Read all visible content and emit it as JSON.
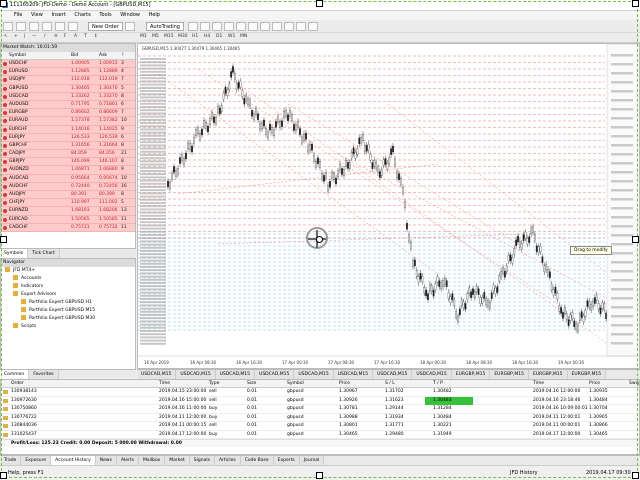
{
  "window": {
    "title": "111165209: JFD-Demo - Demo Account - [GBPUSD,M15]"
  },
  "menu": [
    "File",
    "View",
    "Insert",
    "Charts",
    "Tools",
    "Window",
    "Help"
  ],
  "toolbar": {
    "new_order": "New Order",
    "auto_trading": "AutoTrading"
  },
  "timeframes": [
    "M1",
    "M5",
    "M15",
    "M30",
    "H1",
    "H4",
    "D1",
    "W1",
    "MN"
  ],
  "market_watch": {
    "title": "Market Watch: 16:01:59",
    "columns": [
      "Symbol",
      "Bid",
      "Ask",
      "!"
    ],
    "rows": [
      {
        "symbol": "USDCHF",
        "bid": "1.00905",
        "ask": "1.00915",
        "spread": "3"
      },
      {
        "symbol": "EURUSD",
        "bid": "1.12885",
        "ask": "1.12889",
        "spread": "4"
      },
      {
        "symbol": "USDJPY",
        "bid": "112.018",
        "ask": "112.019",
        "spread": "7"
      },
      {
        "symbol": "GBPUSD",
        "bid": "1.30465",
        "ask": "1.30470",
        "spread": "5"
      },
      {
        "symbol": "USDCAD",
        "bid": "1.33262",
        "ask": "1.33270",
        "spread": "8"
      },
      {
        "symbol": "AUDUSD",
        "bid": "0.71795",
        "ask": "0.71801",
        "spread": "6"
      },
      {
        "symbol": "EURGBP",
        "bid": "0.86602",
        "ask": "0.86609",
        "spread": "7"
      },
      {
        "symbol": "EURAUD",
        "bid": "1.57378",
        "ask": "1.57382",
        "spread": "10"
      },
      {
        "symbol": "EURCHF",
        "bid": "1.14016",
        "ask": "1.14025",
        "spread": "9"
      },
      {
        "symbol": "EURJPY",
        "bid": "126.533",
        "ask": "126.539",
        "spread": "6"
      },
      {
        "symbol": "GBPCHF",
        "bid": "1.31656",
        "ask": "1.31664",
        "spread": "8"
      },
      {
        "symbol": "CADJPY",
        "bid": "84.059",
        "ask": "84.056",
        "spread": "21"
      },
      {
        "symbol": "GBPJPY",
        "bid": "146.099",
        "ask": "146.107",
        "spread": "8"
      },
      {
        "symbol": "AUDNZD",
        "bid": "1.06871",
        "ask": "1.06880",
        "spread": "9"
      },
      {
        "symbol": "AUDCAD",
        "bid": "0.95664",
        "ask": "0.95674",
        "spread": "10"
      },
      {
        "symbol": "AUDCHF",
        "bid": "0.72440",
        "ask": "0.72456",
        "spread": "16"
      },
      {
        "symbol": "AUDJPY",
        "bid": "80.391",
        "ask": "80.399",
        "spread": "8"
      },
      {
        "symbol": "CHFJPY",
        "bid": "110.997",
        "ask": "111.002",
        "spread": "5"
      },
      {
        "symbol": "EURNZD",
        "bid": "1.68193",
        "ask": "1.68206",
        "spread": "13"
      },
      {
        "symbol": "EURCAD",
        "bid": "1.50565",
        "ask": "1.50585",
        "spread": "11"
      },
      {
        "symbol": "CADCHF",
        "bid": "0.75721",
        "ask": "0.75732",
        "spread": "11"
      }
    ],
    "tabs": [
      "Symbols",
      "Tick Chart"
    ]
  },
  "navigator": {
    "title": "Navigator",
    "items": [
      {
        "label": "JFD MT4+",
        "level": 0
      },
      {
        "label": "Accounts",
        "level": 1
      },
      {
        "label": "Indicators",
        "level": 1
      },
      {
        "label": "Expert Advisors",
        "level": 1
      },
      {
        "label": "Portfolio Expert GBPUSD H1",
        "level": 2
      },
      {
        "label": "Portfolio Expert GBPUSD M15",
        "level": 2
      },
      {
        "label": "Portfolio Expert GBPUSD M30",
        "level": 2
      },
      {
        "label": "Scripts",
        "level": 1
      }
    ],
    "tabs": [
      "Common",
      "Favorites"
    ]
  },
  "chart": {
    "info": "GBPUSD,M15  1.30477 1.30479 1.30465 1.30465",
    "tooltip": "Drag to modify",
    "time_labels": [
      "16 Apr 2019",
      "16 Apr 08:30",
      "16 Apr 16:30",
      "17 Apr 00:30",
      "17 Apr 08:30",
      "17 Apr 16:30",
      "18 Apr 00:30",
      "18 Apr 08:30",
      "18 Apr 16:30",
      "19 Apr 00:30"
    ],
    "tabs": [
      "USDCAD,M15",
      "USDCAD,M15",
      "USDCAD,M15",
      "USDCAD,M15",
      "USDCAD,M15",
      "USDCAD,M15",
      "USDCAD,M15",
      "USDCAD,M15",
      "EURGBP,M15",
      "EURGBP,M15",
      "EURGBP,M15",
      "EURGBP,M15"
    ],
    "colors": {
      "sell_line": "#e05050",
      "buy_line": "#4aa8d8",
      "candle": "#1a1a1a"
    }
  },
  "terminal": {
    "columns": [
      "Order",
      "Time",
      "Type",
      "Size",
      "Symbol",
      "Price",
      "S / L",
      "T / P",
      "Time",
      "Price",
      "Swap"
    ],
    "rows": [
      {
        "order": "130938143",
        "time": "2019.04.15 23:00:00",
        "type": "sell",
        "size": "0.01",
        "symbol": "gbpusd",
        "price": "1.30967",
        "sl": "1.31702",
        "tp": "1.30482",
        "ctime": "2019.04.16 12:00:00",
        "cprice": "1.30935",
        "hl": false
      },
      {
        "order": "130972630",
        "time": "2019.04.16 15:00:00",
        "type": "sell",
        "size": "0.01",
        "symbol": "gbpusd",
        "price": "1.30926",
        "sl": "1.31623",
        "tp": "1.30483",
        "ctime": "2019.04.16 23:18:46",
        "cprice": "1.30484",
        "hl": true
      },
      {
        "order": "130750860",
        "time": "2019.04.16 11:00:00",
        "type": "buy",
        "size": "0.01",
        "symbol": "gbpusd",
        "price": "1.30781",
        "sl": "1.29144",
        "tp": "1.31284",
        "ctime": "2019.04.16 10:09:00:01",
        "cprice": "1.30704",
        "hl": false
      },
      {
        "order": "130776722",
        "time": "2019.04.11 12:00:00",
        "type": "buy",
        "size": "0.01",
        "symbol": "gbpusd",
        "price": "1.30988",
        "sl": "1.31934",
        "tp": "1.30484",
        "ctime": "2019.04.11 12:00:01",
        "cprice": "1.30965",
        "hl": false
      },
      {
        "order": "130844036",
        "time": "2019.04.11 00:00:15",
        "type": "sell",
        "size": "0.01",
        "symbol": "gbpusd",
        "price": "1.30801",
        "sl": "1.31771",
        "tp": "1.30221",
        "ctime": "2019.04.11 00:00:01",
        "cprice": "1.30866",
        "hl": false
      },
      {
        "order": "131025437",
        "time": "2019.04.17 12:00:00",
        "type": "buy",
        "size": "0.01",
        "symbol": "gbpusd",
        "price": "1.30465",
        "sl": "1.29480",
        "tp": "1.31949",
        "ctime": "2019.04.17 12:00:00",
        "cprice": "1.30465",
        "hl": false
      }
    ],
    "summary": "Profit/Loss: 125.23  Credit: 0.00  Deposit: 5 000.00  Withdrawal: 0.00",
    "tabs": [
      "Trade",
      "Exposure",
      "Account History",
      "News",
      "Alerts",
      "Mailbox",
      "Market",
      "Signals",
      "Articles",
      "Code Base",
      "Experts",
      "Journal"
    ],
    "active_tab": "Account History"
  },
  "status": {
    "help": "Help, press F1",
    "profile": "JFD History",
    "datetime": "2019.04.17 09:30"
  }
}
